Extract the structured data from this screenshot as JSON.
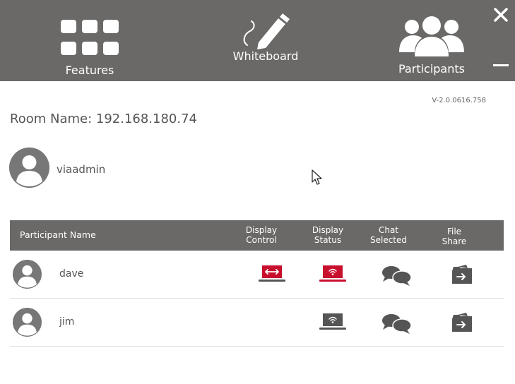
{
  "header": {
    "nav": [
      {
        "label": "Features",
        "icon": "grid-icon"
      },
      {
        "label": "Whiteboard",
        "icon": "pen-icon"
      },
      {
        "label": "Participants",
        "icon": "participants-icon"
      }
    ],
    "close_icon": "close-icon",
    "minimize_icon": "minimize-icon"
  },
  "version": "V-2.0.0616.758",
  "room_name": "Room Name: 192.168.180.74",
  "current_user": {
    "name": "viaadmin"
  },
  "table": {
    "columns": [
      {
        "label": "Participant Name"
      },
      {
        "label_line1": "Display",
        "label_line2": "Control"
      },
      {
        "label_line1": "Display",
        "label_line2": "Status"
      },
      {
        "label_line1": "Chat",
        "label_line2": "Selected"
      },
      {
        "label_line1": "File",
        "label_line2": "Share"
      }
    ],
    "rows": [
      {
        "name": "dave",
        "display_control": "active",
        "display_status": "active"
      },
      {
        "name": "jim",
        "display_control": "none",
        "display_status": "inactive"
      }
    ]
  },
  "colors": {
    "header_bg": "#6b6967",
    "active_red": "#c8102e",
    "icon_gray": "#555555"
  }
}
